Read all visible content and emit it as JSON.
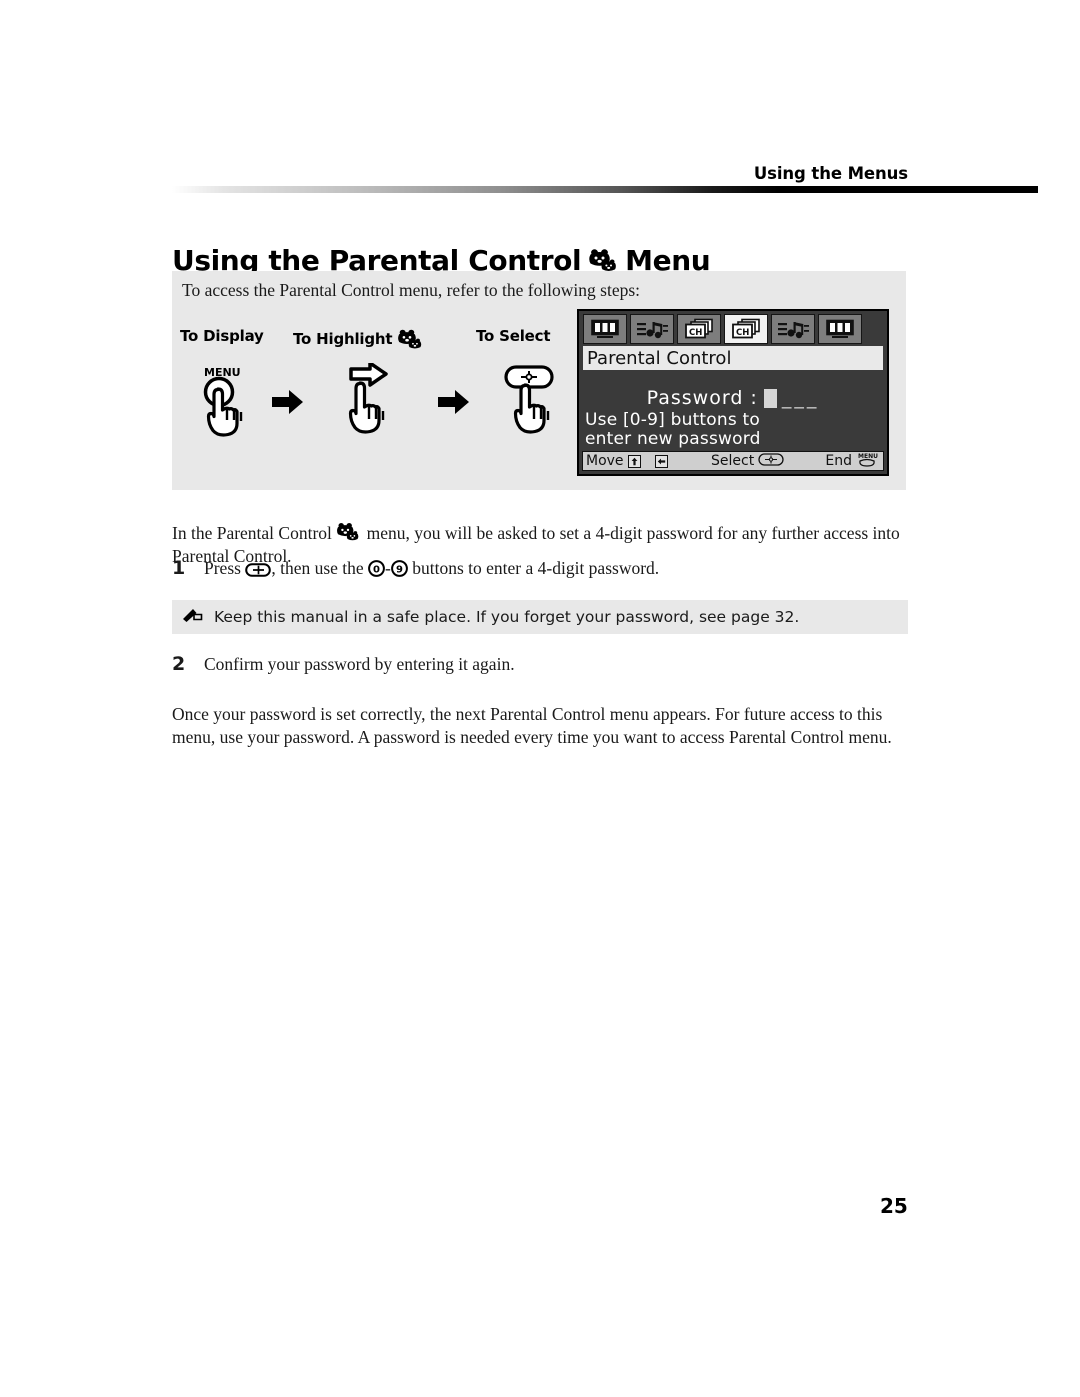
{
  "header": {
    "running_head": "Using the Menus",
    "chapter_title_before": "Using the Parental Control",
    "chapter_title_after": "Menu",
    "icon": "parental-control-bear-icon"
  },
  "panel": {
    "intro": "To access the Parental Control menu, refer to the following steps:",
    "steps": [
      {
        "label": "To Display",
        "glyph": "hand-press-menu-button-icon",
        "button": "MENU"
      },
      {
        "label": "To Highlight",
        "glyph": "hand-press-arrow-button-icon",
        "icon": "parental-control-bear-icon"
      },
      {
        "label": "To Select",
        "glyph": "hand-press-select-button-icon"
      }
    ],
    "arrow": "right-arrow-icon"
  },
  "osd": {
    "menu_icons": [
      {
        "name": "video-menu-icon",
        "selected": false
      },
      {
        "name": "audio-menu-icon",
        "selected": false
      },
      {
        "name": "channel-menu-icon",
        "selected": false
      },
      {
        "name": "channel-menu-icon",
        "selected": true
      },
      {
        "name": "audio-menu-icon",
        "selected": false
      },
      {
        "name": "video-menu-icon",
        "selected": false
      }
    ],
    "title": "Parental Control",
    "password_label": "Password :",
    "password_dashes": "___",
    "hint_line1": "Use [0-9] buttons to",
    "hint_line2": "enter new password",
    "footer": {
      "move_label": "Move",
      "move_key1": "up-down-key-icon",
      "move_key2": "left-right-key-icon",
      "select_label": "Select",
      "select_key": "select-oval-button-icon",
      "end_label": "End",
      "end_key": "MENU"
    },
    "colors": {
      "screen_bg": "#3a3a3a",
      "title_bg": "#e9e9e9",
      "icon_bg": "#7d7d7d",
      "icon_selected_bg": "#f2f2f2",
      "footer_bg": "#cfcfcf"
    }
  },
  "body": {
    "intro_before": "In the Parental Control",
    "intro_after": "menu, you will be asked to set a 4-digit password for any further access into Parental Control.",
    "step1_number": "1",
    "step1_before": "Press",
    "step1_mid": ", then use the",
    "step1_range_from": "0",
    "step1_range_to": "9",
    "step1_after": "buttons to enter a 4-digit password.",
    "note_icon": "pencil-note-icon",
    "note_text": "Keep this manual in a safe place. If you forget your password, see page 32.",
    "step2_number": "2",
    "step2_text": "Confirm your password by entering it again.",
    "closing": "Once your password is set correctly, the next Parental Control menu appears. For future access to this menu, use your password. A password is needed every time you want to access Parental Control menu."
  },
  "footer": {
    "page_number": "25"
  }
}
